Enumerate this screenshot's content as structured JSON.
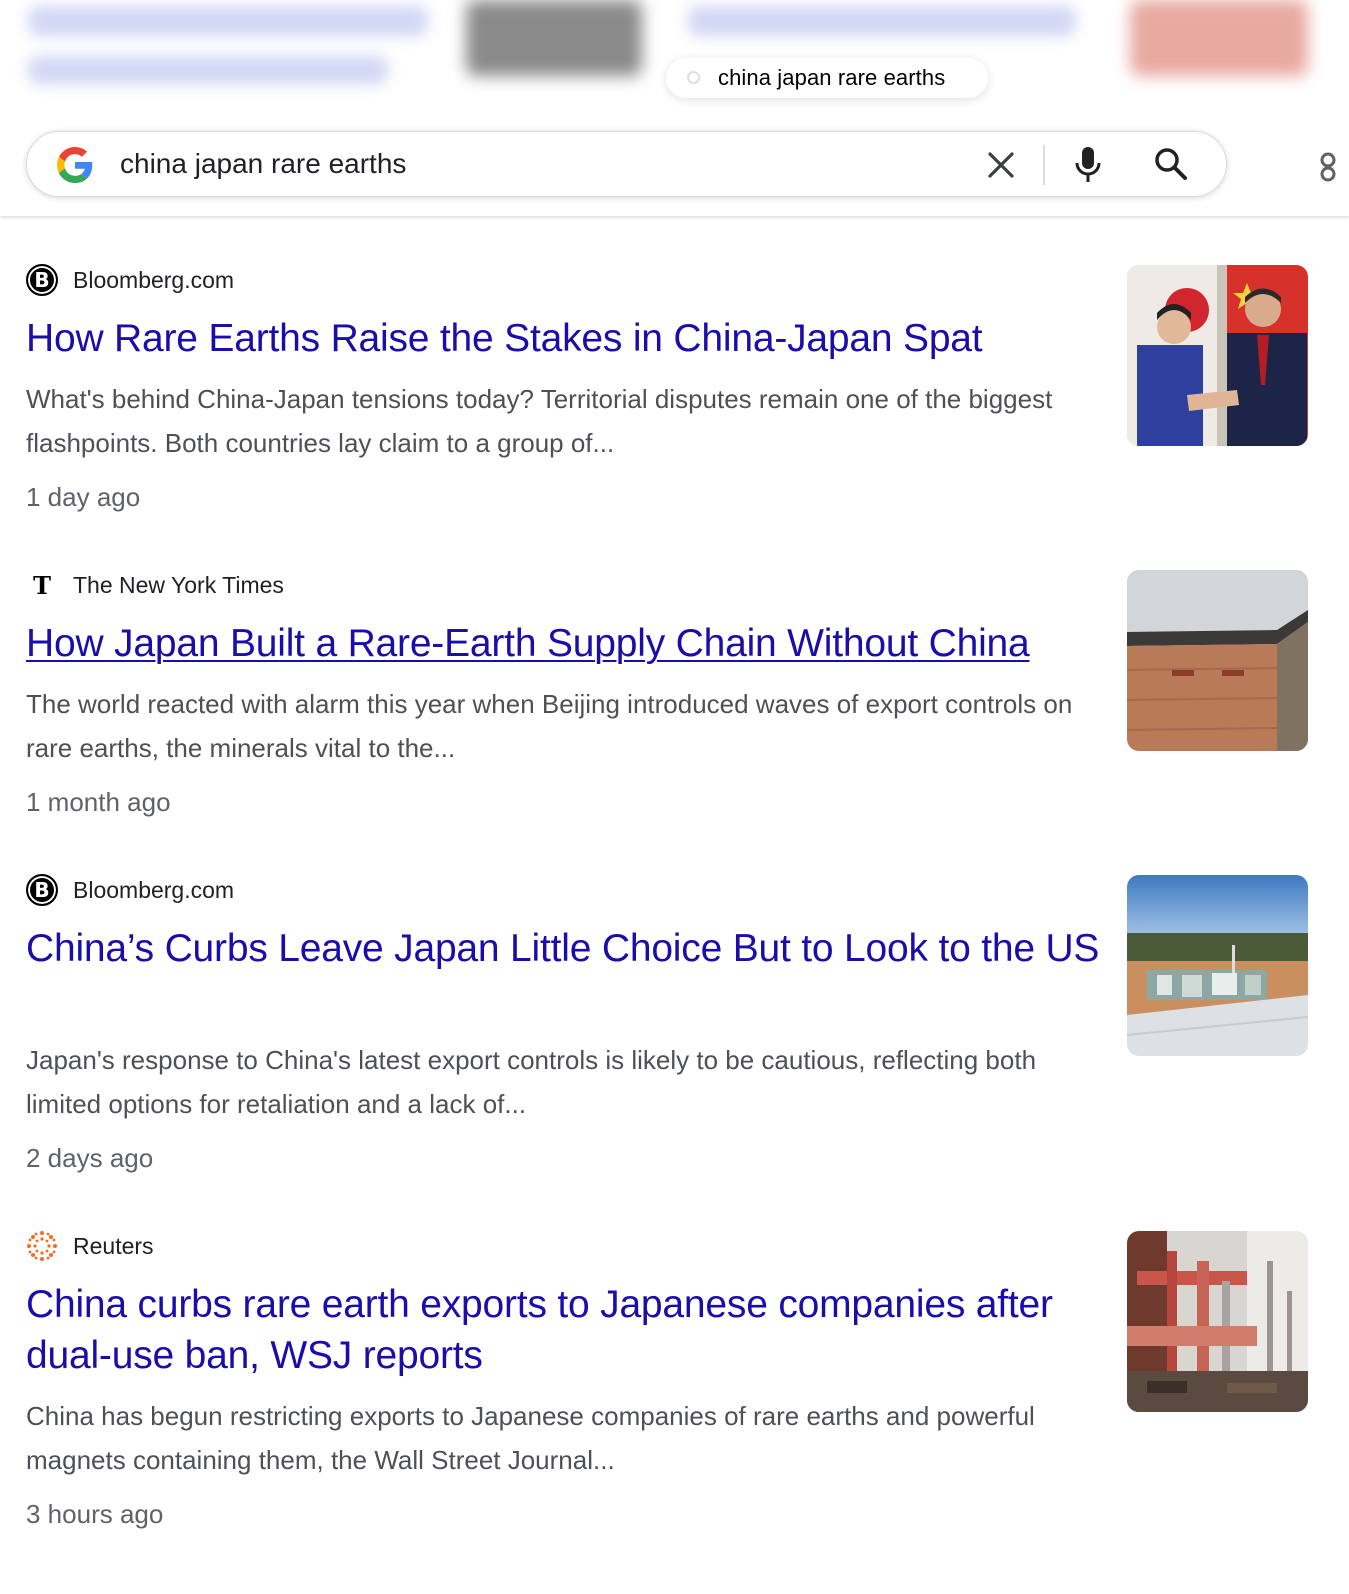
{
  "tooltip": {
    "text": "china japan rare earths"
  },
  "search": {
    "query": "china japan rare earths"
  },
  "results": [
    {
      "source": "Bloomberg.com",
      "favicon": "B",
      "title": "How Rare Earths Raise the Stakes in China-Japan Spat",
      "snippet": "What's behind China-Japan tensions today? Territorial disputes remain one of the biggest flashpoints. Both countries lay claim to a group of...",
      "age": "1 day ago"
    },
    {
      "source": "The New York Times",
      "favicon": "T",
      "title": "How Japan Built a Rare-Earth Supply Chain Without China",
      "snippet": "The world reacted with alarm this year when Beijing introduced waves of export controls on rare earths, the minerals vital to the...",
      "age": "1 month ago"
    },
    {
      "source": "Bloomberg.com",
      "favicon": "B",
      "title": "China’s Curbs Leave Japan Little Choice But to Look to the US",
      "snippet": "Japan's response to China's latest export controls is likely to be cautious, reflecting both limited options for retaliation and a lack of...",
      "age": "2 days ago"
    },
    {
      "source": "Reuters",
      "title": "China curbs rare earth exports to Japanese companies after dual-use ban, WSJ reports",
      "snippet": "China has begun restricting exports to Japanese companies of rare earths and powerful magnets containing them, the Wall Street Journal...",
      "age": "3 hours ago"
    }
  ],
  "colors": {
    "link": "#1a0dab",
    "snippet": "#4d5156",
    "meta": "#5f6368"
  },
  "icons": [
    "google-g-icon",
    "close-icon",
    "mic-icon",
    "search-icon"
  ]
}
